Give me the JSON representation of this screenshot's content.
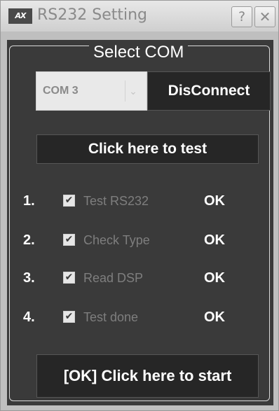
{
  "window": {
    "title": "RS232 Setting",
    "logo_text": "AX",
    "help_glyph": "?",
    "close_glyph": "✕"
  },
  "group": {
    "legend": "Select COM"
  },
  "com": {
    "selected": "COM 3",
    "arrow_icon": "chevron-down-icon",
    "arrow_glyph": "⌄"
  },
  "buttons": {
    "disconnect": "DisConnect",
    "test": "Click here to test",
    "start": "[OK] Click here to start"
  },
  "steps": [
    {
      "number": "1.",
      "label": "Test RS232",
      "checked": true,
      "check_glyph": "✔",
      "status": "OK"
    },
    {
      "number": "2.",
      "label": "Check Type",
      "checked": true,
      "check_glyph": "✔",
      "status": "OK"
    },
    {
      "number": "3.",
      "label": "Read DSP",
      "checked": true,
      "check_glyph": "✔",
      "status": "OK"
    },
    {
      "number": "4.",
      "label": "Test done",
      "checked": true,
      "check_glyph": "✔",
      "status": "OK"
    }
  ],
  "colors": {
    "panel": "#3a3a3a",
    "button": "#262626",
    "text_light": "#ffffff",
    "text_dim": "#7e7e7e"
  }
}
